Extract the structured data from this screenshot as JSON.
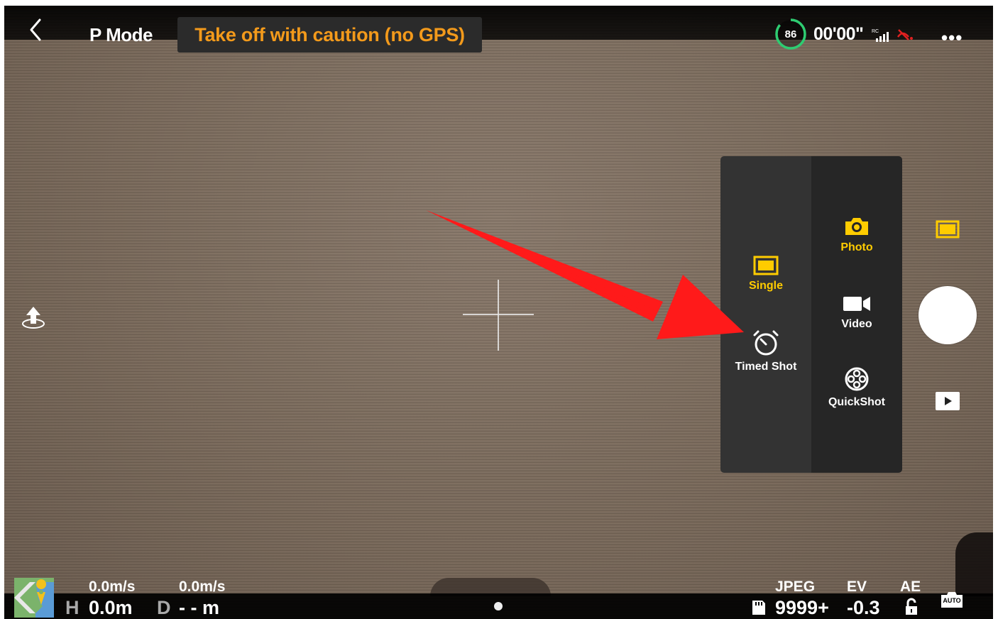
{
  "header": {
    "mode_label": "P Mode",
    "warning_text": "Take off with caution (no GPS)",
    "battery_percent": "86",
    "flight_time": "00'00\"",
    "more_label": "•••"
  },
  "mode_menu": {
    "left_items": [
      {
        "label": "Single",
        "icon": "single-photo-icon",
        "selected": true
      },
      {
        "label": "Timed Shot",
        "icon": "timer-icon",
        "selected": false
      }
    ],
    "right_items": [
      {
        "label": "Photo",
        "icon": "camera-icon",
        "selected": true
      },
      {
        "label": "Video",
        "icon": "video-camera-icon",
        "selected": false
      },
      {
        "label": "QuickShot",
        "icon": "film-reel-icon",
        "selected": false
      }
    ]
  },
  "telemetry": {
    "h_speed": "0.0m/s",
    "v_speed": "0.0m/s",
    "h_label": "H",
    "h_value": "0.0m",
    "d_label": "D",
    "d_value": "- - m"
  },
  "camera": {
    "format": "JPEG",
    "ev_label": "EV",
    "ae_label": "AE",
    "remaining": "9999+",
    "ev_value": "-0.3",
    "auto_label": "AUTO"
  },
  "colors": {
    "warning": "#f39a1b",
    "selected": "#ffcc00",
    "battery_ring": "#2ecc71",
    "annotation_arrow": "#ff1a1a"
  }
}
